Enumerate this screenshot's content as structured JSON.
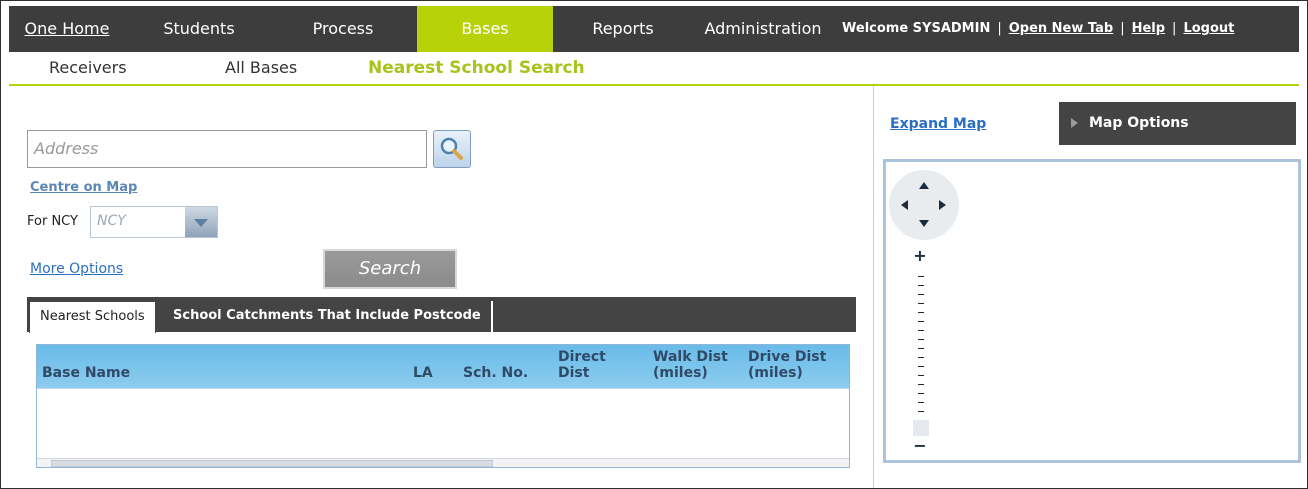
{
  "topnav": {
    "items": [
      {
        "label": "One Home",
        "active": false
      },
      {
        "label": "Students",
        "active": false
      },
      {
        "label": "Process",
        "active": false
      },
      {
        "label": "Bases",
        "active": true
      },
      {
        "label": "Reports",
        "active": false
      },
      {
        "label": "Administration",
        "active": false
      }
    ],
    "welcome": "Welcome  SYSADMIN",
    "open_new_tab": "Open New Tab",
    "help": "Help",
    "logout": "Logout",
    "sep": "|"
  },
  "subnav": {
    "items": [
      {
        "label": "Receivers",
        "active": false
      },
      {
        "label": "All Bases",
        "active": false
      },
      {
        "label": "Nearest School Search",
        "active": true
      }
    ]
  },
  "search": {
    "address_placeholder": "Address",
    "centre_on_map": "Centre on Map",
    "for_ncy_label": "For NCY",
    "ncy_placeholder": "NCY",
    "more_options": "More Options",
    "search_button": "Search"
  },
  "tabs": [
    {
      "label": "Nearest Schools",
      "active": true
    },
    {
      "label": "School Catchments That Include Postcode",
      "active": false
    }
  ],
  "grid": {
    "columns": [
      "Base Name",
      "LA",
      "Sch. No.",
      "Direct Dist",
      "Walk Dist (miles)",
      "Drive Dist (miles)"
    ],
    "rows": []
  },
  "map": {
    "expand_map": "Expand Map",
    "map_options": "Map Options",
    "zoom_in": "+",
    "zoom_out": "−"
  },
  "colors": {
    "accent": "#b7d209",
    "nav_bg": "#3d3d3d",
    "link": "#2b6fc3",
    "grid_header": "#69bbe9"
  }
}
